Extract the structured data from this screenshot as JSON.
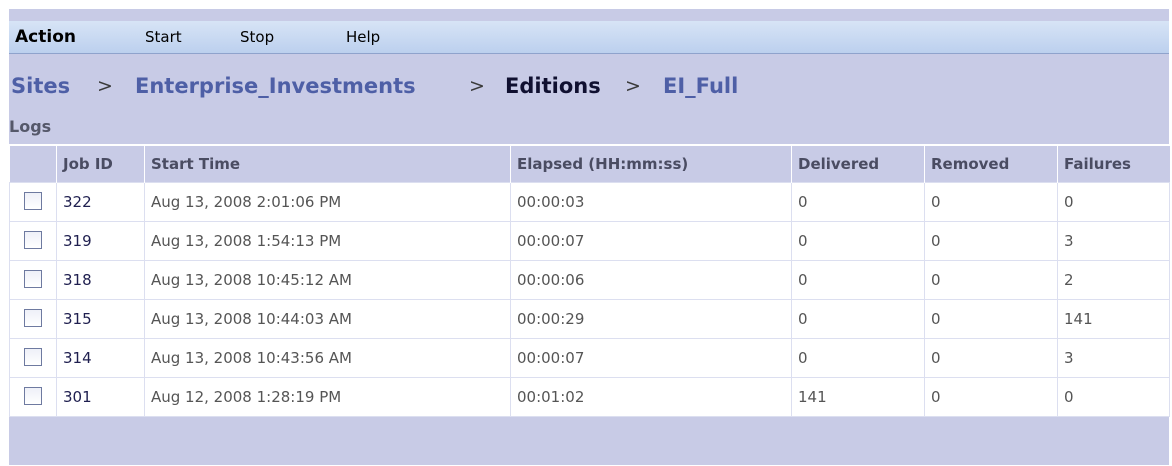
{
  "menu": {
    "action": "Action",
    "start": "Start",
    "stop": "Stop",
    "help": "Help"
  },
  "breadcrumb": {
    "sites": "Sites",
    "enterprise": "Enterprise_Investments",
    "editions": "Editions",
    "edition": "EI_Full",
    "separator": ">"
  },
  "logs": {
    "title": "Logs",
    "columns": {
      "job_id": "Job ID",
      "start_time": "Start Time",
      "elapsed": "Elapsed (HH:mm:ss)",
      "delivered": "Delivered",
      "removed": "Removed",
      "failures": "Failures"
    },
    "rows": [
      {
        "job_id": "322",
        "start_time": "Aug 13, 2008 2:01:06 PM",
        "elapsed": "00:00:03",
        "delivered": "0",
        "removed": "0",
        "failures": "0"
      },
      {
        "job_id": "319",
        "start_time": "Aug 13, 2008 1:54:13 PM",
        "elapsed": "00:00:07",
        "delivered": "0",
        "removed": "0",
        "failures": "3"
      },
      {
        "job_id": "318",
        "start_time": "Aug 13, 2008 10:45:12 AM",
        "elapsed": "00:00:06",
        "delivered": "0",
        "removed": "0",
        "failures": "2"
      },
      {
        "job_id": "315",
        "start_time": "Aug 13, 2008 10:44:03 AM",
        "elapsed": "00:00:29",
        "delivered": "0",
        "removed": "0",
        "failures": "141"
      },
      {
        "job_id": "314",
        "start_time": "Aug 13, 2008 10:43:56 AM",
        "elapsed": "00:00:07",
        "delivered": "0",
        "removed": "0",
        "failures": "3"
      },
      {
        "job_id": "301",
        "start_time": "Aug 12, 2008 1:28:19 PM",
        "elapsed": "00:01:02",
        "delivered": "141",
        "removed": "0",
        "failures": "0"
      }
    ]
  }
}
